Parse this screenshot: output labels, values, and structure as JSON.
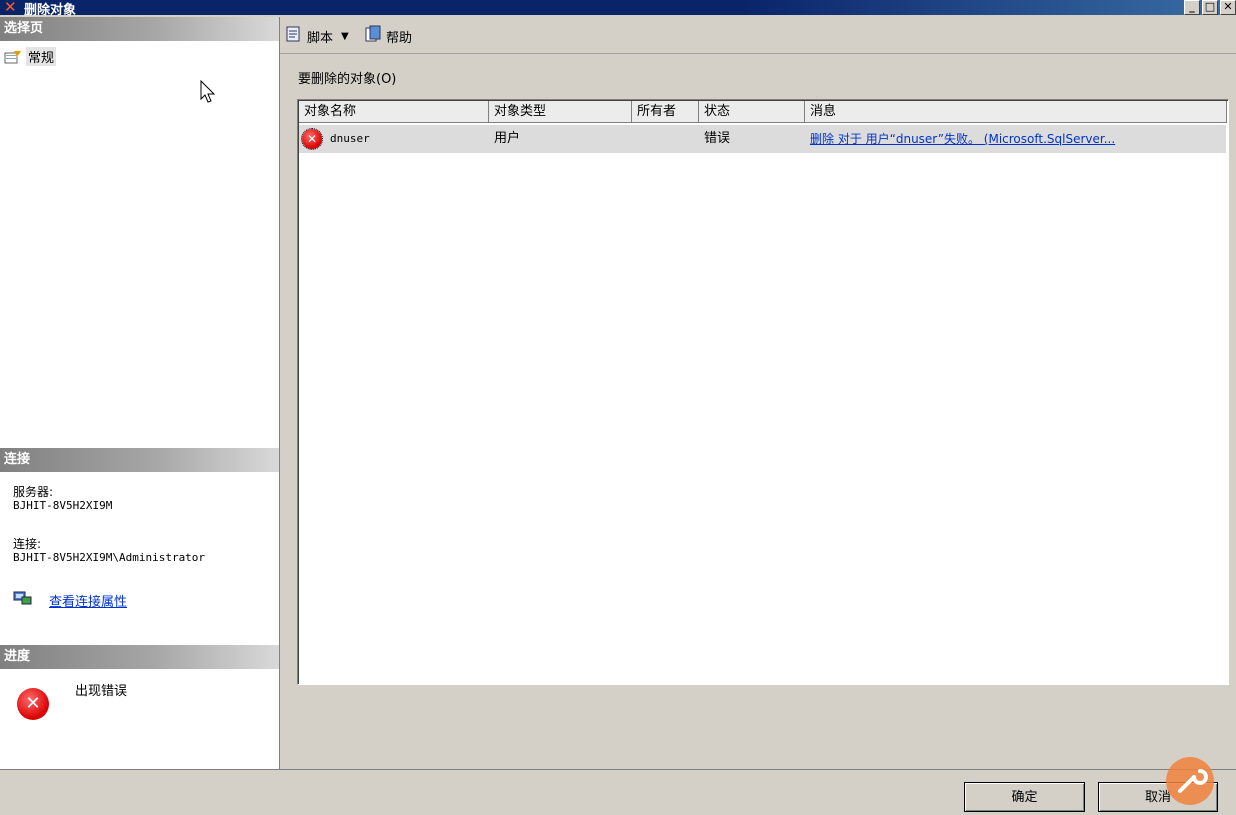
{
  "window": {
    "title": "删除对象",
    "icon": "delete-x-icon"
  },
  "left": {
    "select_page_header": "选择页",
    "nav_items": [
      {
        "label": "常规",
        "icon": "properties-page-icon"
      }
    ],
    "connection_header": "连接",
    "server_label": "服务器:",
    "server_value": "BJHIT-8V5H2XI9M",
    "connection_label": "连接:",
    "connection_value": "BJHIT-8V5H2XI9M\\Administrator",
    "view_conn_link": "查看连接属性",
    "progress_header": "进度",
    "progress_status": "出现错误"
  },
  "toolbar": {
    "script_label": "脚本",
    "help_label": "帮助"
  },
  "main": {
    "caption": "要删除的对象(O)",
    "columns": [
      "对象名称",
      "对象类型",
      "所有者",
      "状态",
      "消息"
    ],
    "rows": [
      {
        "name": "dnuser",
        "type": "用户",
        "owner": "",
        "status": "错误",
        "message": "删除 对于 用户“dnuser”失败。 (Microsoft.SqlServer..."
      }
    ]
  },
  "buttons": {
    "ok": "确定",
    "cancel": "取消"
  },
  "colors": {
    "titlebar": "#0a246a",
    "link": "#0033cc",
    "error": "#d80000"
  }
}
